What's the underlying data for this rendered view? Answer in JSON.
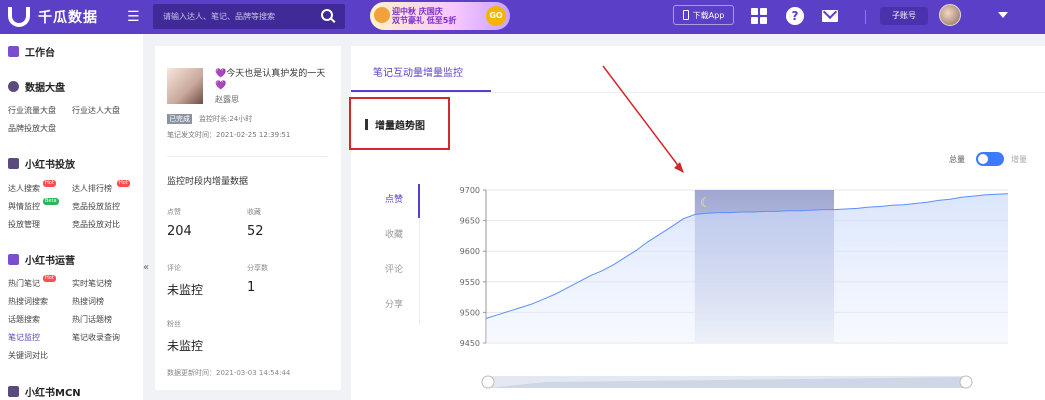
{
  "header": {
    "brand": "千瓜数据",
    "search_placeholder": "请输入达人、笔记、品牌等搜索",
    "promo_line1": "迎中秋 庆国庆",
    "promo_line2": "双节豪礼 低至5折",
    "promo_badge": "GO",
    "download_label": "下载App",
    "help_label": "?",
    "subaccount_label": "子账号"
  },
  "sidebar": {
    "workbench": "工作台",
    "sections": [
      {
        "title": "数据大盘"
      },
      {
        "title": "小红书投放"
      },
      {
        "title": "小红书运营"
      },
      {
        "title": "小红书MCN"
      }
    ],
    "items": {
      "industry_traffic": "行业流量大盘",
      "industry_kol": "行业达人大盘",
      "brand_delivery": "品牌投放大盘",
      "kol_search": "达人搜索",
      "kol_ranking": "达人排行榜",
      "sentiment": "舆情监控",
      "competitor_monitor": "竞品投放监控",
      "delivery_manage": "投放管理",
      "competitor_compare": "竞品投放对比",
      "hot_notes": "热门笔记",
      "realtime_notes": "实时笔记榜",
      "hot_word_search": "热搜词搜索",
      "hot_word_rank": "热搜词榜",
      "topic_search": "话题搜索",
      "hot_topic_rank": "热门话题榜",
      "note_monitor": "笔记监控",
      "note_index": "笔记收录查询",
      "keyword_compare": "关键词对比"
    },
    "badges": {
      "hot": "Hot",
      "beta": "Beta"
    },
    "collapse_icon": "«"
  },
  "note": {
    "title": "💜今天也是认真护发的一天💜",
    "author": "赵露思",
    "monitor_tag": "已完成",
    "monitor_duration": "监控时长:24小时",
    "publish_time": "笔记发文时间：2021-02-25 12:39:51",
    "increment_title": "监控时段内增量数据",
    "stats": [
      {
        "label": "点赞",
        "value": "204"
      },
      {
        "label": "收藏",
        "value": "52"
      },
      {
        "label": "评论",
        "value": "未监控"
      },
      {
        "label": "分享数",
        "value": "1"
      },
      {
        "label": "粉丝",
        "value": "未监控"
      }
    ],
    "update_time": "数据更新时间：2021-03-03 14:54:44"
  },
  "main": {
    "tab_label": "笔记互动量增量监控",
    "trend_title": "增量趋势图",
    "toggle_total": "总量",
    "toggle_increment": "增量",
    "metric_tabs": [
      "点赞",
      "收藏",
      "评论",
      "分享"
    ]
  },
  "colors": {
    "accent": "#5b3fc6",
    "line": "#5b8ff9",
    "annotation": "#d12a2a"
  },
  "chart_data": {
    "type": "area",
    "series": [
      {
        "values": [
          9490,
          9496,
          9502,
          9508,
          9514,
          9522,
          9530,
          9540,
          9550,
          9560,
          9568,
          9578,
          9590,
          9602,
          9616,
          9628,
          9640,
          9653,
          9660,
          9662,
          9663,
          9663,
          9664,
          9664,
          9665,
          9665,
          9666,
          9666,
          9667,
          9668,
          9668,
          9669,
          9670,
          9672,
          9673,
          9675,
          9676,
          9678,
          9680,
          9683,
          9685,
          9688,
          9690,
          9692,
          9693,
          9694
        ]
      }
    ],
    "y_ticks": [
      9450,
      9500,
      9550,
      9600,
      9650,
      9700
    ],
    "ylim": [
      9450,
      9700
    ],
    "grid": true,
    "night_band": {
      "start_index": 18,
      "end_index": 30,
      "icon": "moon-icon"
    }
  }
}
